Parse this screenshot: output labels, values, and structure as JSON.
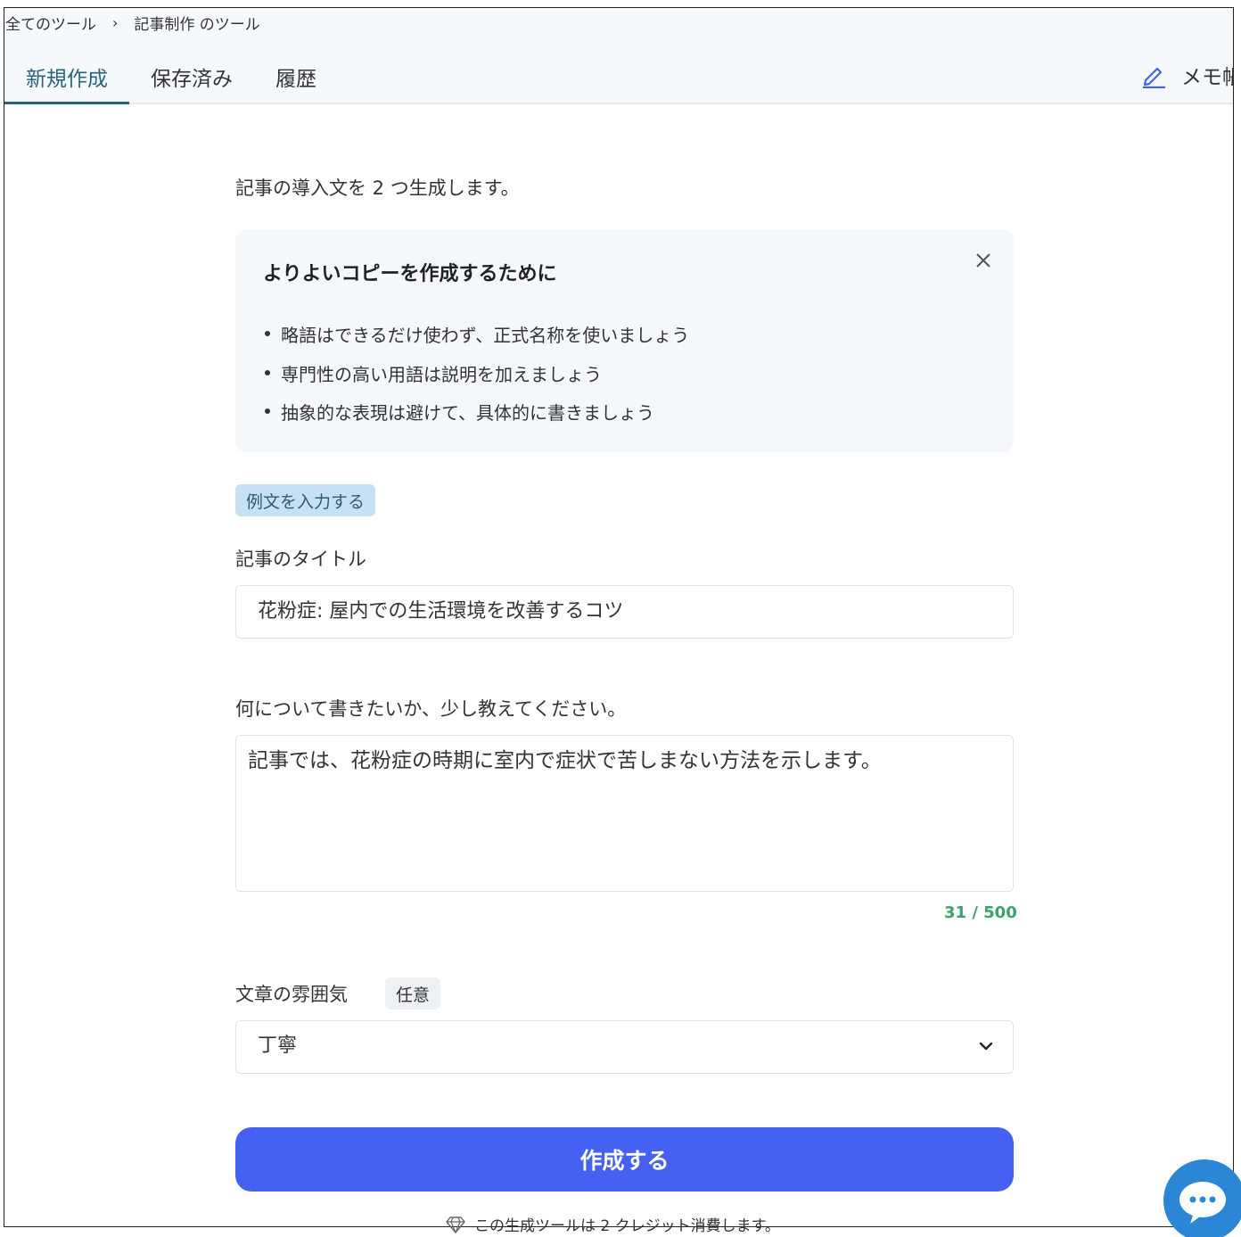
{
  "breadcrumb": {
    "root": "全てのツール",
    "separator": "›",
    "current": "記事制作 のツール"
  },
  "tabs": [
    {
      "label": "新規作成",
      "active": true
    },
    {
      "label": "保存済み",
      "active": false
    },
    {
      "label": "履歴",
      "active": false
    }
  ],
  "memo": {
    "label": "メモ帳",
    "icon": "pencil-icon"
  },
  "intro": "記事の導入文を 2 つ生成します。",
  "tips": {
    "title": "よりよいコピーを作成するために",
    "close_icon": "close-icon",
    "items": [
      "略語はできるだけ使わず、正式名称を使いましょう",
      "専門性の高い用語は説明を加えましょう",
      "抽象的な表現は避けて、具体的に書きましょう"
    ]
  },
  "example_button": "例文を入力する",
  "article_title": {
    "label": "記事のタイトル",
    "value": "花粉症: 屋内での生活環境を改善するコツ"
  },
  "description": {
    "label": "何について書きたいか、少し教えてください。",
    "value": "記事では、花粉症の時期に室内で症状で苦しまない方法を示します。",
    "counter": "31 / 500"
  },
  "tone": {
    "label": "文章の雰囲気",
    "optional_badge": "任意",
    "selected": "丁寧"
  },
  "submit_label": "作成する",
  "credit_note": "この生成ツールは 2 クレジット消費します。",
  "colors": {
    "primary": "#4461f2",
    "accent": "#2a6380",
    "counter": "#3aa36a",
    "badge": "#c6e1f5",
    "chat": "#2b86d6"
  }
}
